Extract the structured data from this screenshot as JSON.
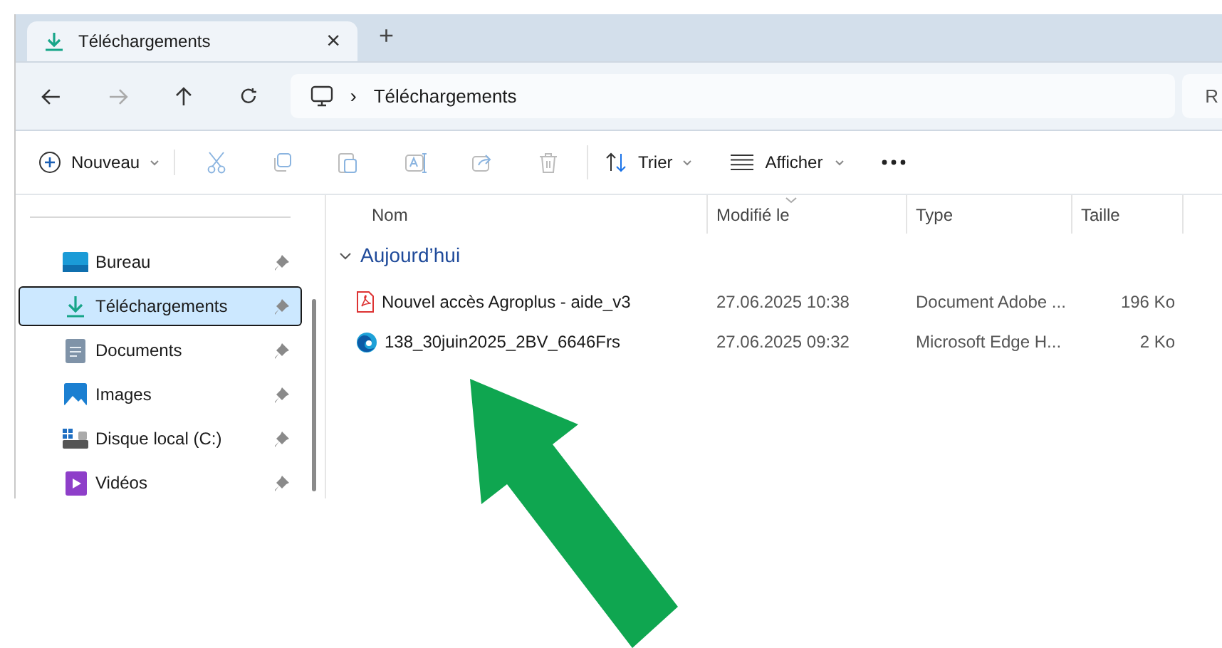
{
  "tab": {
    "title": "Téléchargements",
    "close": "×",
    "new": "+"
  },
  "address": {
    "separator": "›",
    "location": "Téléchargements",
    "search_fragment": "R"
  },
  "toolbar": {
    "new": "Nouveau",
    "sort": "Trier",
    "view": "Afficher"
  },
  "sidebar": {
    "items": [
      {
        "label": "Bureau",
        "selected": false
      },
      {
        "label": "Téléchargements",
        "selected": true
      },
      {
        "label": "Documents",
        "selected": false
      },
      {
        "label": "Images",
        "selected": false
      },
      {
        "label": "Disque local (C:)",
        "selected": false
      },
      {
        "label": "Vidéos",
        "selected": false
      }
    ]
  },
  "table": {
    "columns": [
      "Nom",
      "Modifié le",
      "Type",
      "Taille"
    ],
    "group": "Aujourd’hui",
    "rows": [
      {
        "name": "Nouvel accès Agroplus - aide_v3",
        "modified": "27.06.2025 10:38",
        "type": "Document Adobe ...",
        "size": "196 Ko"
      },
      {
        "name": "138_30juin2025_2BV_6646Frs",
        "modified": "27.06.2025 09:32",
        "type": "Microsoft Edge H...",
        "size": "2 Ko"
      }
    ]
  }
}
